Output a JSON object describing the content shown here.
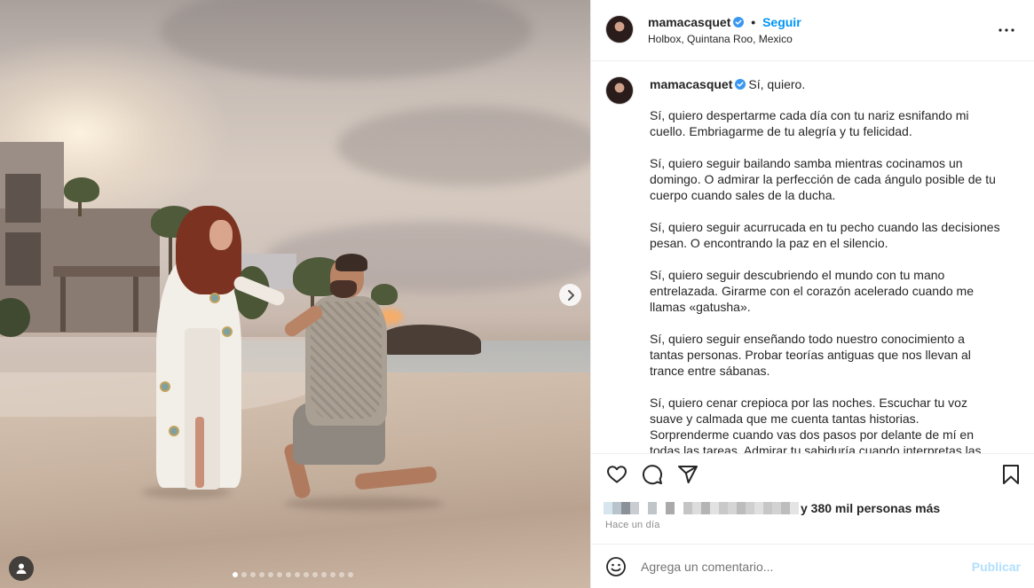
{
  "post": {
    "username": "mamacasquet",
    "follow_label": "Seguir",
    "separator": "•",
    "location": "Holbox, Quintana Roo, Mexico"
  },
  "caption": {
    "username": "mamacasquet",
    "title": "Sí, quiero.",
    "paragraphs": [
      "Sí, quiero despertarme cada día con tu nariz esnifando mi cuello. Embriagarme de tu alegría y tu felicidad.",
      "Sí, quiero seguir bailando samba mientras cocinamos un domingo. O admirar la perfección de cada ángulo posible de tu cuerpo cuando sales de la ducha.",
      "Sí, quiero seguir acurrucada en tu pecho cuando las decisiones pesan. O encontrando la paz en el silencio.",
      "Sí, quiero seguir descubriendo el mundo con tu mano entrelazada. Girarme con el corazón acelerado cuando me llamas «gatusha».",
      "Sí, quiero seguir enseñando todo nuestro conocimiento a tantas personas. Probar teorías antiguas que nos llevan al trance entre sábanas.",
      "Sí, quiero cenar crepioca por las noches. Escuchar tu voz suave y calmada que me cuenta tantas historias. Sorprenderme cuando vas dos pasos por delante de mí en todas las tareas. Admirar tu sabiduría cuando interpretas las"
    ]
  },
  "engagement": {
    "likes_text": "y 380 mil personas más",
    "timestamp": "Hace un día"
  },
  "comment_box": {
    "placeholder": "Agrega un comentario...",
    "publish_label": "Publicar"
  },
  "carousel": {
    "total_slides": 14,
    "current_slide": 1
  },
  "icons": {
    "verified": "verified-badge-icon",
    "more": "more-options-icon",
    "like": "heart-icon",
    "comment": "comment-icon",
    "share": "paper-plane-icon",
    "save": "bookmark-icon",
    "emoji": "emoji-icon",
    "next": "chevron-right-icon",
    "tag": "user-tag-icon"
  },
  "colors": {
    "accent": "#0095f6",
    "verified": "#3897f0",
    "publish_disabled": "#b2dffc",
    "text": "#262626",
    "muted": "#8e8e8e"
  }
}
